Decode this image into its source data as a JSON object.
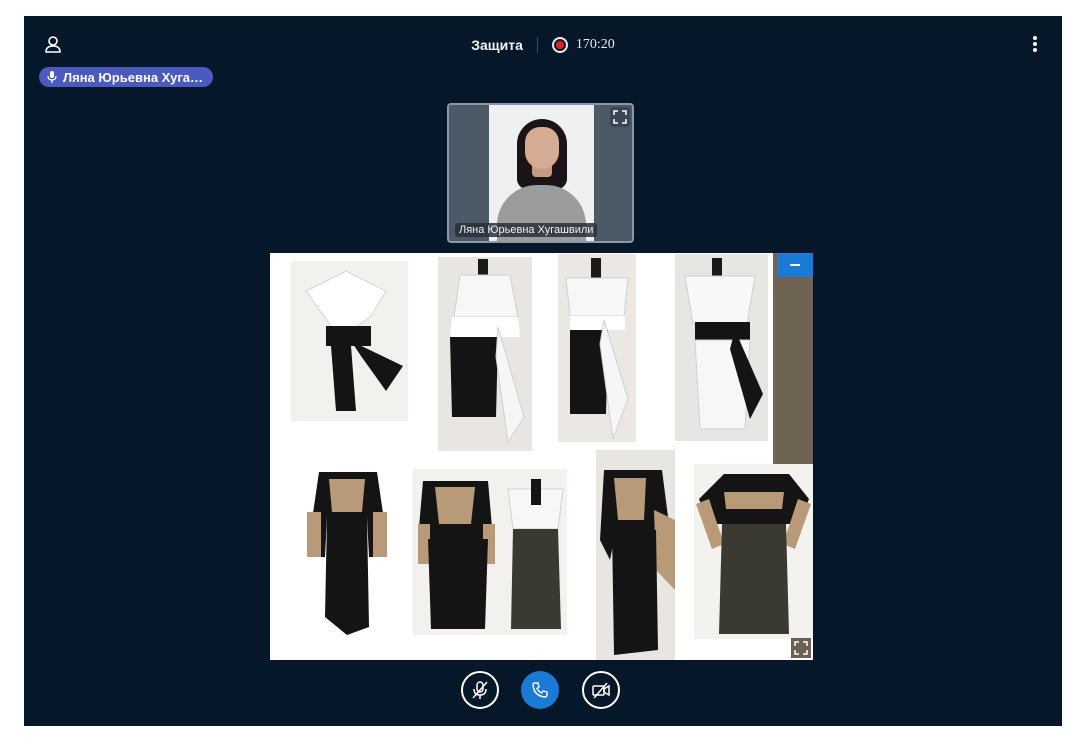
{
  "header": {
    "meeting_title": "Защита",
    "recording_time": "170:20"
  },
  "talking_indicator": {
    "name": "Ляна Юрьевна Хуга…"
  },
  "webcam": {
    "participant_name": "Ляна Юрьевна Хугашвили"
  },
  "controls": {
    "mic": "muted-microphone-icon",
    "leave": "phone-icon",
    "camera": "camera-off-icon"
  },
  "colors": {
    "background": "#06172a",
    "accent": "#1b7ad6",
    "talker_badge": "#4a5abf",
    "recording": "#e02020"
  }
}
